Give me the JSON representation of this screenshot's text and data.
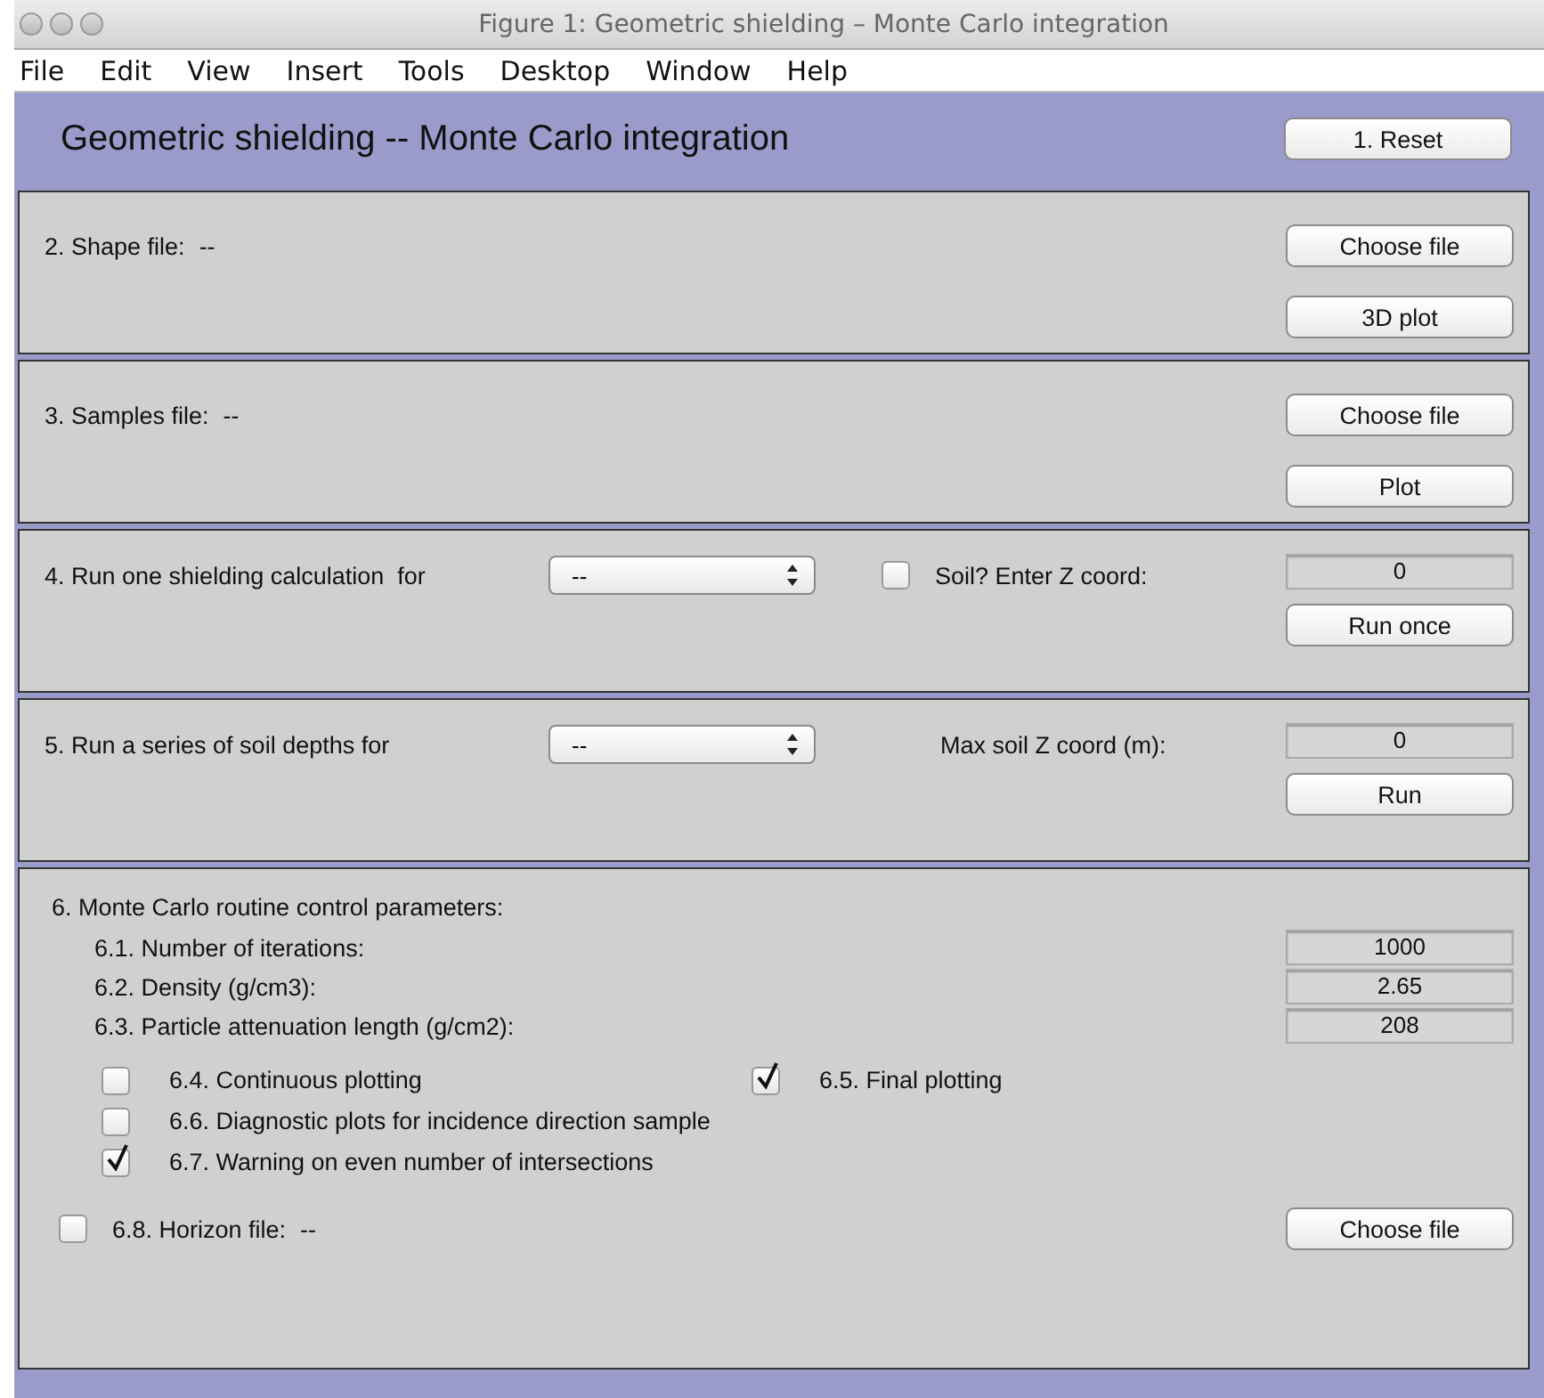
{
  "window": {
    "title": "Figure 1: Geometric shielding – Monte Carlo integration"
  },
  "menu": [
    "File",
    "Edit",
    "View",
    "Insert",
    "Tools",
    "Desktop",
    "Window",
    "Help"
  ],
  "header": {
    "title": "Geometric shielding -- Monte Carlo integration",
    "button": "1. Reset"
  },
  "sections": [
    {
      "kind": "file",
      "label": "2. Shape file:",
      "value": "--",
      "buttons": [
        "Choose file",
        "3D plot"
      ]
    },
    {
      "kind": "file",
      "label": "3. Samples file:",
      "value": "--",
      "buttons": [
        "Choose file",
        "Plot"
      ]
    },
    {
      "kind": "run",
      "label": "4. Run one shielding calculation  for",
      "select": "--",
      "checkbox": {
        "label": "Soil? Enter Z coord:",
        "checked": false
      },
      "field": "0",
      "button": "Run once"
    },
    {
      "kind": "run",
      "label": "5. Run a series of soil depths for",
      "select": "--",
      "field_label": "Max soil Z coord (m):",
      "field": "0",
      "button": "Run"
    }
  ],
  "parameters": {
    "title": "6. Monte Carlo routine control parameters:",
    "fields": [
      {
        "label": "6.1. Number of iterations:",
        "value": "1000"
      },
      {
        "label": "6.2. Density (g/cm3):",
        "value": "2.65"
      },
      {
        "label": "6.3. Particle attenuation length (g/cm2):",
        "value": "208"
      }
    ],
    "option_rows": [
      {
        "options": [
          {
            "label": "6.4. Continuous plotting",
            "checked": false
          },
          {
            "label": "6.5. Final plotting",
            "checked": true
          }
        ]
      },
      {
        "options": [
          {
            "label": "6.6. Diagnostic plots for incidence direction sample",
            "checked": false
          }
        ]
      },
      {
        "options": [
          {
            "label": "6.7. Warning on even number of intersections",
            "checked": true
          }
        ]
      }
    ],
    "horizon": {
      "label": "6.8. Horizon file:",
      "value": "--",
      "checked": false,
      "button": "Choose file"
    }
  }
}
